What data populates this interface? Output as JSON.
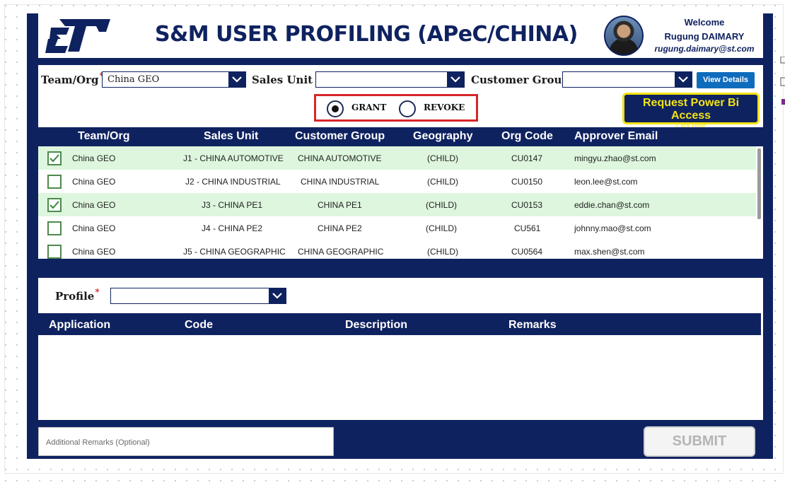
{
  "header": {
    "title": "S&M USER PROFILING (APeC/CHINA)",
    "welcome": "Welcome",
    "user_name": "Rugung DAIMARY",
    "user_email": "rugung.daimary@st.com"
  },
  "filters": {
    "team_org": {
      "label": "Team/Org",
      "required_mark": "*",
      "value": "China GEO"
    },
    "sales_unit": {
      "label": "Sales Unit",
      "value": ""
    },
    "customer_group": {
      "label": "Customer Group",
      "value": ""
    },
    "view_details_label": "View Details",
    "grant_label": "GRANT",
    "revoke_label": "REVOKE",
    "selected_action": "GRANT",
    "request_access_label": "Request Power Bi Access",
    "request_access_sub": "Click Here"
  },
  "grid": {
    "columns": [
      "Team/Org",
      "Sales Unit",
      "Customer Group",
      "Geography",
      "Org Code",
      "Approver Email"
    ],
    "rows": [
      {
        "checked": true,
        "team": "China GEO",
        "sales_unit": "J1 - CHINA AUTOMOTIVE",
        "customer_group": "CHINA AUTOMOTIVE",
        "geography": "(CHILD)",
        "org_code": "CU0147",
        "email": "mingyu.zhao@st.com"
      },
      {
        "checked": false,
        "team": "China GEO",
        "sales_unit": "J2 - CHINA INDUSTRIAL",
        "customer_group": "CHINA INDUSTRIAL",
        "geography": "(CHILD)",
        "org_code": "CU0150",
        "email": "leon.lee@st.com"
      },
      {
        "checked": true,
        "team": "China GEO",
        "sales_unit": "J3 - CHINA PE1",
        "customer_group": "CHINA PE1",
        "geography": "(CHILD)",
        "org_code": "CU0153",
        "email": "eddie.chan@st.com"
      },
      {
        "checked": false,
        "team": "China GEO",
        "sales_unit": "J4 - CHINA PE2",
        "customer_group": "CHINA PE2",
        "geography": "(CHILD)",
        "org_code": "CU561",
        "email": "johnny.mao@st.com"
      },
      {
        "checked": false,
        "team": "China GEO",
        "sales_unit": "J5 - CHINA GEOGRAPHIC",
        "customer_group": "CHINA GEOGRAPHIC",
        "geography": "(CHILD)",
        "org_code": "CU0564",
        "email": "max.shen@st.com"
      }
    ]
  },
  "profile": {
    "label": "Profile",
    "required_mark": "*",
    "value": "",
    "columns": [
      "Application",
      "Code",
      "Description",
      "Remarks"
    ]
  },
  "footer": {
    "remarks_placeholder": "Additional Remarks (Optional)",
    "submit_label": "SUBMIT"
  },
  "colors": {
    "primary": "#0f2260",
    "selected_row": "#ddf6dd",
    "accent_yellow": "#f2e314",
    "highlight_red": "#d7262a",
    "button_blue": "#0f6cbd"
  }
}
